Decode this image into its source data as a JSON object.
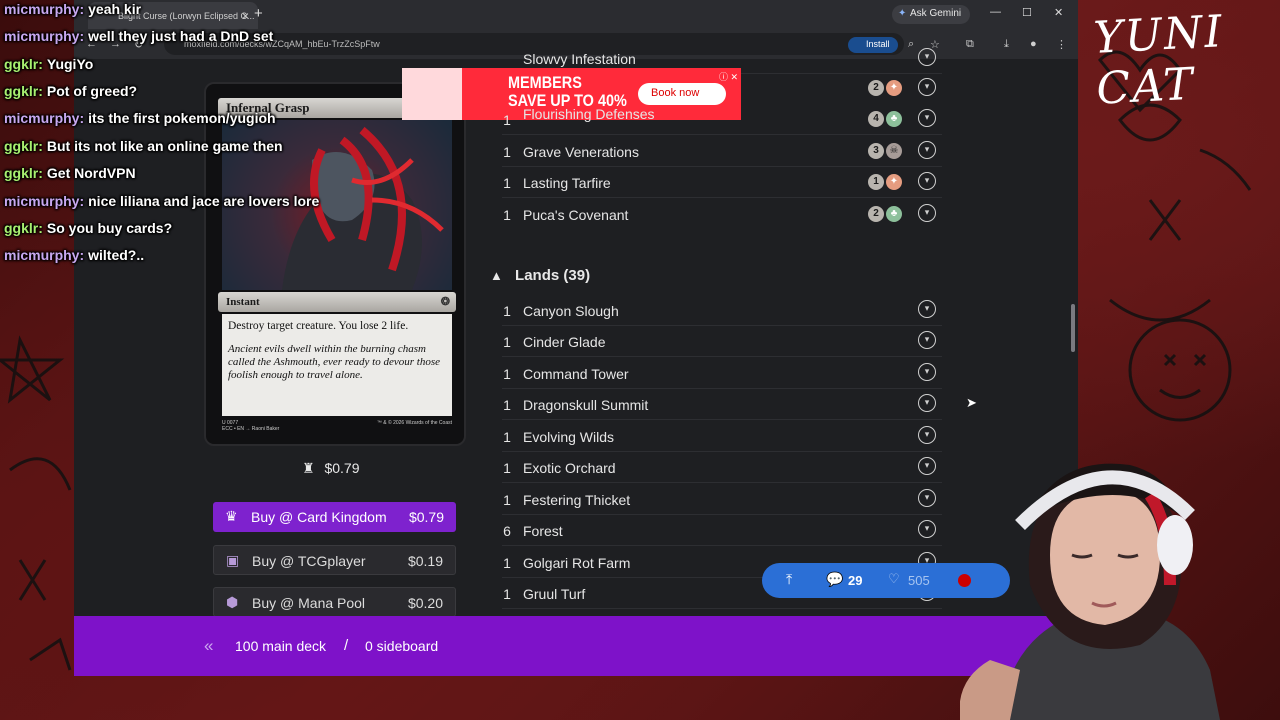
{
  "chat": [
    {
      "user": "micmurphy:",
      "message": "yeah kir",
      "color": "#c8a8f0"
    },
    {
      "user": "micmurphy:",
      "message": "well they just had a DnD set",
      "color": "#c8a8f0"
    },
    {
      "user": "ggklr:",
      "message": "YugiYo",
      "color": "#a8f070"
    },
    {
      "user": "ggklr:",
      "message": "Pot of greed?",
      "color": "#a8f070"
    },
    {
      "user": "micmurphy:",
      "message": "its the first pokemon/yugioh",
      "color": "#c8a8f0"
    },
    {
      "user": "ggklr:",
      "message": "But its not like an online game then",
      "color": "#a8f070"
    },
    {
      "user": "ggklr:",
      "message": "Get NordVPN",
      "color": "#a8f070"
    },
    {
      "user": "micmurphy:",
      "message": "nice liliana and jace are lovers lore",
      "color": "#c8a8f0"
    },
    {
      "user": "ggklr:",
      "message": "So you buy cards?",
      "color": "#a8f070"
    },
    {
      "user": "micmurphy:",
      "message": "wilted?..",
      "color": "#c8a8f0"
    }
  ],
  "overlay": {
    "logo": "YUNI CAT"
  },
  "browser": {
    "tab_title": "Blight Curse (Lorwyn Eclipsed C...",
    "url": "moxfield.com/decks/wZCqAM_hbEu-TrzZcSpFtw",
    "ask_gemini": "Ask Gemini",
    "install": "Install"
  },
  "ad": {
    "headline_1": "MEMBERS",
    "headline_2": "SAVE UP TO 40%",
    "cta": "Book now"
  },
  "card": {
    "name": "Infernal Grasp",
    "mana_cost": "1 ⚉",
    "type": "Instant",
    "rules_text": "Destroy target creature. You lose 2 life.",
    "flavor_text": "Ancient evils dwell within the burning chasm called the Ashmouth, ever ready to devour those foolish enough to travel alone.",
    "footer_left": "U 0077\nECC • EN → Raoni Baker",
    "footer_right": "™ & © 2026 Wizards of the Coast",
    "price": "$0.79"
  },
  "buy_buttons": [
    {
      "label": "Buy @ Card Kingdom",
      "price": "$0.79"
    },
    {
      "label": "Buy @ TCGplayer",
      "price": "$0.19"
    },
    {
      "label": "Buy @ Mana Pool",
      "price": "$0.20"
    }
  ],
  "deck": {
    "partial_rows": [
      {
        "qty": "",
        "name": "Slowvy Infestation",
        "mana": [
          "gen",
          "b"
        ]
      },
      {
        "qty": "1",
        "name": "Flourishing Defenses",
        "mana": [
          "4",
          "g"
        ]
      },
      {
        "qty": "1",
        "name": "Grave Venerations",
        "mana": [
          "3",
          "b"
        ]
      },
      {
        "qty": "1",
        "name": "Lasting Tarfire",
        "mana": [
          "1",
          "r"
        ]
      },
      {
        "qty": "1",
        "name": "Puca's Covenant",
        "mana": [
          "2",
          "g"
        ]
      }
    ],
    "first_row_mana": [
      "2",
      "r"
    ],
    "lands_header": "Lands (39)",
    "lands": [
      {
        "qty": "1",
        "name": "Canyon Slough"
      },
      {
        "qty": "1",
        "name": "Cinder Glade"
      },
      {
        "qty": "1",
        "name": "Command Tower"
      },
      {
        "qty": "1",
        "name": "Dragonskull Summit"
      },
      {
        "qty": "1",
        "name": "Evolving Wilds"
      },
      {
        "qty": "1",
        "name": "Exotic Orchard"
      },
      {
        "qty": "1",
        "name": "Festering Thicket"
      },
      {
        "qty": "6",
        "name": "Forest"
      },
      {
        "qty": "1",
        "name": "Golgari Rot Farm"
      },
      {
        "qty": "1",
        "name": "Gruul Turf"
      }
    ]
  },
  "bottom_bar": {
    "main": "100 main deck",
    "separator": "/",
    "side": "0 sideboard"
  },
  "float_pill": {
    "comments": "29",
    "likes": "505"
  },
  "colors": {
    "accent_purple": "#7e12c9",
    "buy_purple": "#7e22ce",
    "pill_blue": "#2b6fd6"
  }
}
